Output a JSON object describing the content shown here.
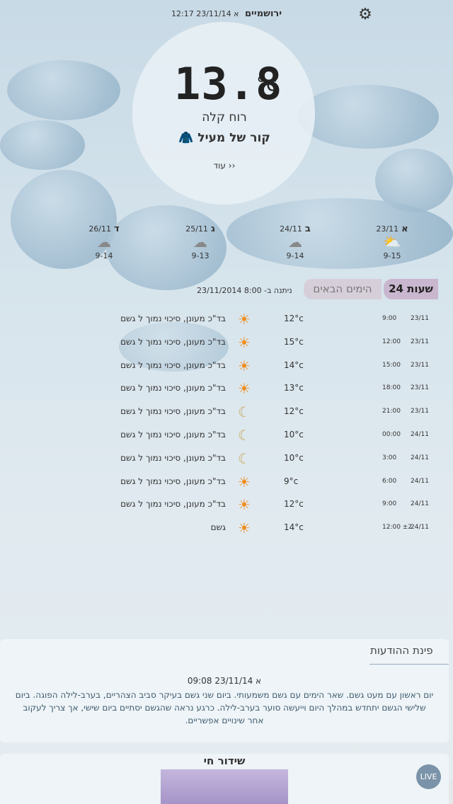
{
  "header": {
    "city": "ירושמיים",
    "datetime": "א 23/11/14 12:17",
    "settings_icon": "gear-icon"
  },
  "current": {
    "temperature": "13.8",
    "unit": "°c",
    "wind": "רוח קלה",
    "feel": "קור של מעיל",
    "more_label": "עוד ››"
  },
  "forecast_days": [
    {
      "letter": "א",
      "date": "23/11",
      "icon": "sun-cloud-rain-icon",
      "range": "9-15"
    },
    {
      "letter": "ב",
      "date": "24/11",
      "icon": "cloud-rain-icon",
      "range": "9-14"
    },
    {
      "letter": "ג",
      "date": "25/11",
      "icon": "cloud-rain-icon",
      "range": "9-13"
    },
    {
      "letter": "ד",
      "date": "26/11",
      "icon": "cloud-rain-icon",
      "range": "9-14"
    }
  ],
  "tabs": {
    "hours_label": "24 שעות",
    "days_label": "הימים הבאים",
    "issued": "ניתנה ב- 8:00 23/11/2014"
  },
  "hourly": [
    {
      "date": "23/11",
      "hour": "9:00",
      "temp": "12°c",
      "icon": "sun-cloud-icon",
      "desc": "בד\"כ מעונן, סיכוי נמוך ל גשם"
    },
    {
      "date": "23/11",
      "hour": "12:00",
      "temp": "15°c",
      "icon": "sun-cloud-icon",
      "desc": "בד\"כ מעונן, סיכוי נמוך ל גשם"
    },
    {
      "date": "23/11",
      "hour": "15:00",
      "temp": "14°c",
      "icon": "sun-cloud-icon",
      "desc": "בד\"כ מעונן, סיכוי נמוך ל גשם"
    },
    {
      "date": "23/11",
      "hour": "18:00",
      "temp": "13°c",
      "icon": "sun-cloud-icon",
      "desc": "בד\"כ מעונן, סיכוי נמוך ל גשם"
    },
    {
      "date": "23/11",
      "hour": "21:00",
      "temp": "12°c",
      "icon": "moon-icon",
      "desc": "בד\"כ מעונן, סיכוי נמוך ל גשם"
    },
    {
      "date": "24/11",
      "hour": "00:00",
      "temp": "10°c",
      "icon": "moon-icon",
      "desc": "בד\"כ מעונן, סיכוי נמוך ל גשם"
    },
    {
      "date": "24/11",
      "hour": "3:00",
      "temp": "10°c",
      "icon": "moon-icon",
      "desc": "בד\"כ מעונן, סיכוי נמוך ל גשם"
    },
    {
      "date": "24/11",
      "hour": "6:00",
      "temp": "9°c",
      "icon": "sun-cloud-icon",
      "desc": "בד\"כ מעונן, סיכוי נמוך ל גשם"
    },
    {
      "date": "24/11",
      "hour": "9:00",
      "temp": "12°c",
      "icon": "sun-cloud-icon",
      "desc": "בד\"כ מעונן, סיכוי נמוך ל גשם"
    },
    {
      "date": "24/11",
      "hour": "12:00 ±2",
      "temp": "14°c",
      "icon": "sun-cloud-icon",
      "desc": "גשם"
    }
  ],
  "notice": {
    "title": "פינת ההודעות",
    "date": "א 23/11/14 09:08",
    "text": "יום ראשון עם מעט גשם. שאר הימים עם גשם משמעותי. ביום שני גשם בעיקר סביב הצהריים, בערב-לילה הפוגה. ביום שלישי הגשם יתחדש במהלך היום וייעשה סוער בערב-לילה. כרגע נראה שהגשם יסתיים ביום שישי, אך צריך לעקוב אחר שינויים אפשריים."
  },
  "live": {
    "title": "שידור חי",
    "button": "LIVE"
  }
}
